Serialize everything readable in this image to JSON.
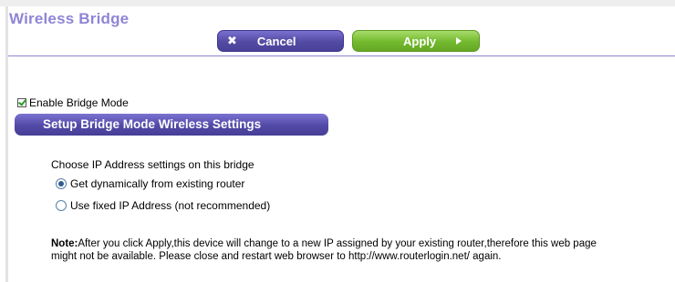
{
  "header": {
    "title": "Wireless Bridge",
    "cancel_label": "Cancel",
    "apply_label": "Apply"
  },
  "bridge": {
    "enable_label": "Enable Bridge Mode",
    "enable_checked": true,
    "section_title": "Setup Bridge Mode Wireless Settings",
    "choose_label": "Choose IP Address settings on this bridge",
    "options": [
      {
        "label": "Get dynamically from existing router",
        "selected": true
      },
      {
        "label": "Use fixed IP Address (not recommended)",
        "selected": false
      }
    ]
  },
  "note": {
    "prefix": "Note:",
    "line1": "After you click Apply,this device will change to a new IP assigned by your existing router,therefore this web page",
    "line2": "might not be available. Please close and restart web browser to http://www.routerlogin.net/ again."
  },
  "colors": {
    "title": "#8e85d6",
    "cancel_button": "#534aa3",
    "apply_button": "#73b92e",
    "section_bar": "#5249a6"
  }
}
